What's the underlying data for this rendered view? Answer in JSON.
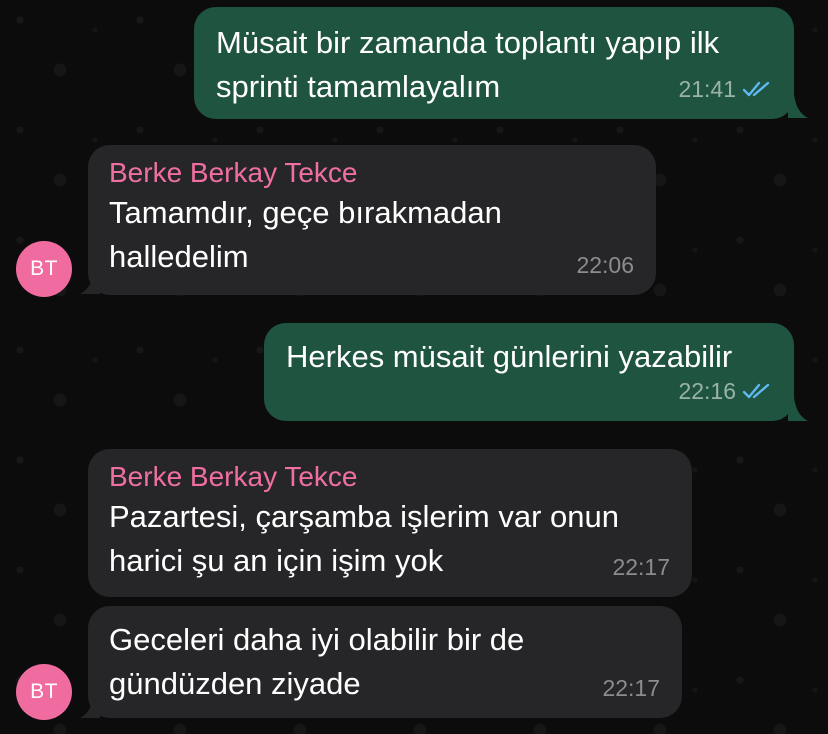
{
  "chat": {
    "messages": [
      {
        "direction": "out",
        "text": "Müsait bir zamanda toplantı yapıp ilk\nsprinti tamamlayalım",
        "time": "21:41",
        "status": "read"
      },
      {
        "direction": "in",
        "sender": "Berke Berkay Tekce",
        "text": "Tamamdır, geçe bırakmadan\nhalledelim",
        "time": "22:06",
        "avatar": "BT"
      },
      {
        "direction": "out",
        "text": "Herkes müsait günlerini yazabilir",
        "time": "22:16",
        "status": "read"
      },
      {
        "direction": "in",
        "sender": "Berke Berkay Tekce",
        "text": "Pazartesi, çarşamba işlerim var onun\nharici şu an için işim yok",
        "time": "22:17"
      },
      {
        "direction": "in",
        "text": "Geceleri daha iyi olabilir bir de\ngündüzden ziyade",
        "time": "22:17",
        "avatar": "BT"
      }
    ]
  },
  "colors": {
    "outgoing_bubble": "#1e5440",
    "incoming_bubble": "#262628",
    "sender_name": "#ef6fa2",
    "read_ticks": "#5fb8f0",
    "avatar_bg": "#f06ca0"
  },
  "icons": {
    "read_status": "double-check-icon"
  }
}
